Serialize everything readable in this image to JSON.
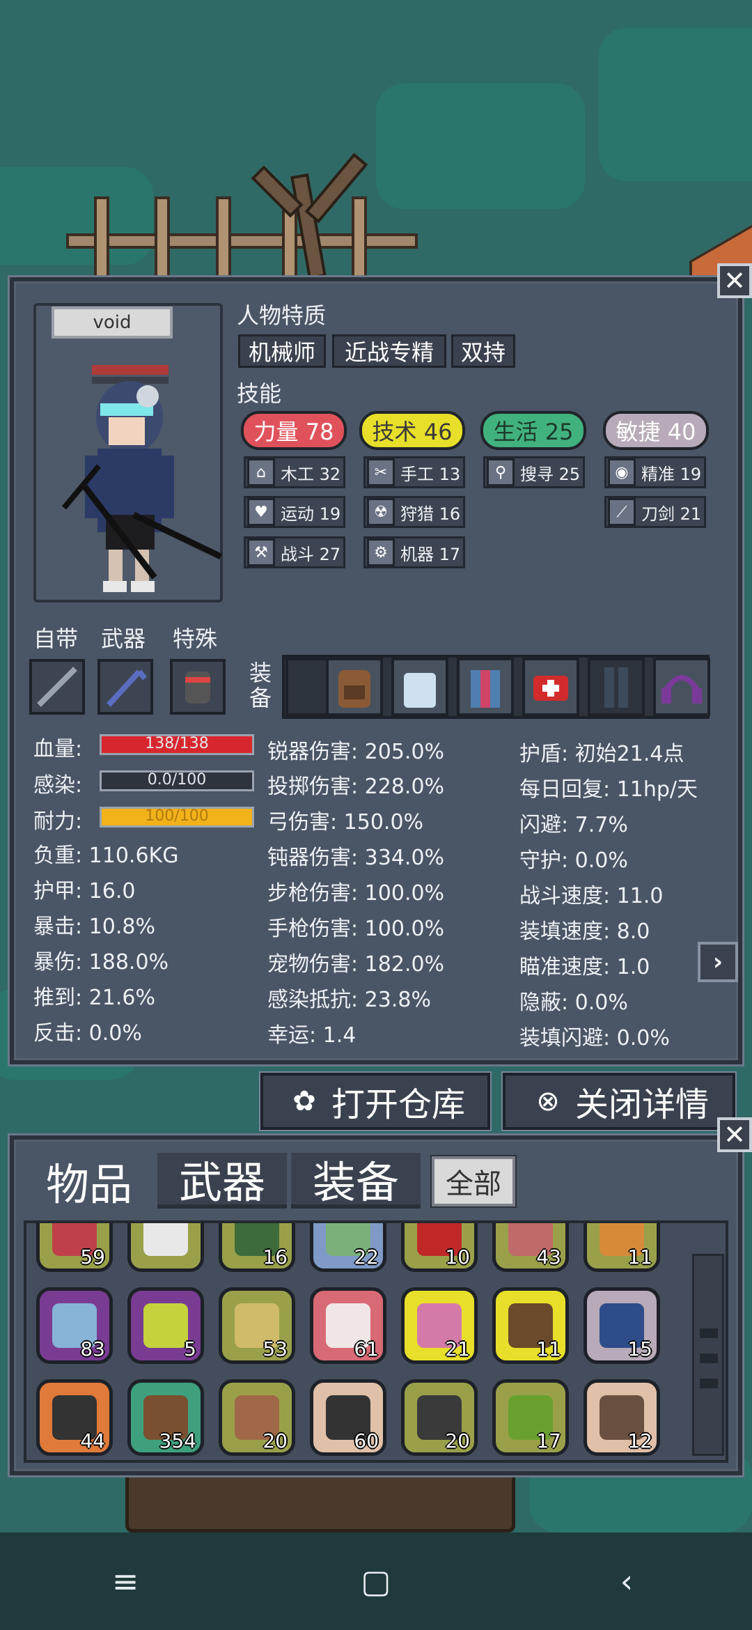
{
  "character": {
    "name": "void"
  },
  "traits": {
    "title": "人物特质",
    "items": [
      "机械师",
      "近战专精",
      "双持"
    ]
  },
  "skills": {
    "title": "技能",
    "main": [
      {
        "label": "力量 78",
        "color": "#e0525b"
      },
      {
        "label": "技术 46",
        "color": "#e8df2a"
      },
      {
        "label": "生活 25",
        "color": "#41b27e"
      },
      {
        "label": "敏捷 40",
        "color": "#b8aab8"
      }
    ],
    "sub": [
      {
        "label": "木工 32",
        "icon": "house-icon",
        "glyph": "⌂"
      },
      {
        "label": "手工 13",
        "icon": "scissors-icon",
        "glyph": "✂"
      },
      {
        "label": "搜寻 25",
        "icon": "magnifier-icon",
        "glyph": "⚲"
      },
      {
        "label": "精准 19",
        "icon": "eye-icon",
        "glyph": "◉"
      },
      {
        "label": "运动 19",
        "icon": "heart-icon",
        "glyph": "♥"
      },
      {
        "label": "狩猎 16",
        "icon": "radiation-icon",
        "glyph": "☢"
      },
      {
        "label": "刀剑 21",
        "icon": "blade-icon",
        "glyph": "⟋"
      },
      {
        "label": "战斗 27",
        "icon": "axe-icon",
        "glyph": "⚒"
      },
      {
        "label": "机器 17",
        "icon": "gear-icon",
        "glyph": "⚙"
      }
    ]
  },
  "slots": {
    "innate": "自带",
    "weapon": "武器",
    "special": "特殊",
    "equip": "装备"
  },
  "stats": {
    "hp_label": "血量:",
    "hp_text": "138/138",
    "hp_fraction": 1.0,
    "infect_label": "感染:",
    "infect_text": "0.0/100",
    "infect_fraction": 0.0,
    "stamina_label": "耐力:",
    "stamina_text": "100/100",
    "stamina_fraction": 1.0,
    "col1": [
      "负重: 110.6KG",
      "护甲: 16.0",
      "暴击: 10.8%",
      "暴伤: 188.0%",
      "推到: 21.6%",
      "反击: 0.0%"
    ],
    "col2": [
      "锐器伤害: 205.0%",
      "投掷伤害: 228.0%",
      "弓伤害: 150.0%",
      "钝器伤害: 334.0%",
      "步枪伤害: 100.0%",
      "手枪伤害: 100.0%",
      "宠物伤害: 182.0%",
      "感染抵抗: 23.8%",
      "幸运: 1.4"
    ],
    "col3": [
      "护盾: 初始21.4点",
      "每日回复: 11hp/天",
      "闪避: 7.7%",
      "守护: 0.0%",
      "战斗速度: 11.0",
      "装填速度: 8.0",
      "瞄准速度: 1.0",
      "隐蔽: 0.0%",
      "装填闪避: 0.0%"
    ]
  },
  "buttons": {
    "open_storage": "打开仓库",
    "close_details": "关闭详情"
  },
  "inventory": {
    "tabs": [
      "物品",
      "武器",
      "装备"
    ],
    "filter": "全部",
    "items": [
      {
        "count": "59",
        "bg": "#9aa04a",
        "ic": "#c0404a"
      },
      {
        "count": "",
        "bg": "#9aa04a",
        "ic": "#e8e8e8"
      },
      {
        "count": "16",
        "bg": "#9aa04a",
        "ic": "#3d6b3a"
      },
      {
        "count": "22",
        "bg": "#7f9ac6",
        "ic": "#7bb07a"
      },
      {
        "count": "10",
        "bg": "#9aa04a",
        "ic": "#c02828"
      },
      {
        "count": "43",
        "bg": "#9aa04a",
        "ic": "#c06a6a"
      },
      {
        "count": "11",
        "bg": "#9aa04a",
        "ic": "#d78a3a"
      },
      {
        "count": "83",
        "bg": "#7a3c93",
        "ic": "#86b3d6"
      },
      {
        "count": "5",
        "bg": "#7a3c93",
        "ic": "#c4d23c"
      },
      {
        "count": "53",
        "bg": "#9aa04a",
        "ic": "#cfbb6a"
      },
      {
        "count": "61",
        "bg": "#d86a75",
        "ic": "#f0e6e6"
      },
      {
        "count": "21",
        "bg": "#e8df2a",
        "ic": "#d47aa8"
      },
      {
        "count": "11",
        "bg": "#e8df2a",
        "ic": "#6a4a2a"
      },
      {
        "count": "15",
        "bg": "#b8aab8",
        "ic": "#2f4c8a"
      },
      {
        "count": "44",
        "bg": "#e07a3a",
        "ic": "#333333"
      },
      {
        "count": "354",
        "bg": "#3fa07e",
        "ic": "#7a5030"
      },
      {
        "count": "20",
        "bg": "#9aa04a",
        "ic": "#a06848"
      },
      {
        "count": "60",
        "bg": "#e0c0a8",
        "ic": "#333333"
      },
      {
        "count": "20",
        "bg": "#9aa04a",
        "ic": "#3a3a3a"
      },
      {
        "count": "17",
        "bg": "#9aa04a",
        "ic": "#6aa030"
      },
      {
        "count": "12",
        "bg": "#e0c0a8",
        "ic": "#6a5040"
      }
    ]
  },
  "colors": {
    "hp": "#d8262e",
    "stamina": "#f2b21a",
    "panel": "#4a5565"
  }
}
